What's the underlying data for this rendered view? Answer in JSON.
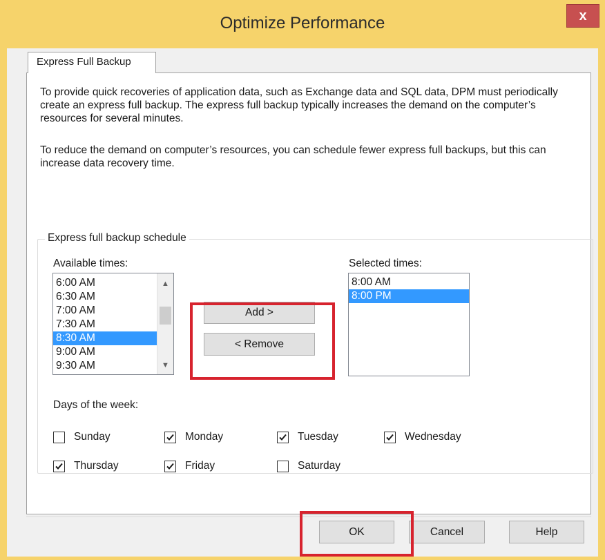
{
  "window": {
    "title": "Optimize Performance",
    "close_label": "x"
  },
  "tabs": [
    {
      "label": "Express Full Backup"
    }
  ],
  "description": {
    "para1": "To provide quick recoveries of application data, such as Exchange data and SQL data, DPM must periodically create an express full backup. The express full backup typically increases the demand on the computer’s resources for several minutes.",
    "para2": "To reduce the demand on computer’s resources, you can schedule fewer express full backups, but this can increase data recovery time."
  },
  "schedule": {
    "group_title": "Express full backup schedule",
    "available_label": "Available times:",
    "available_times": [
      {
        "label": "6:00 AM",
        "selected": false
      },
      {
        "label": "6:30 AM",
        "selected": false
      },
      {
        "label": "7:00 AM",
        "selected": false
      },
      {
        "label": "7:30 AM",
        "selected": false
      },
      {
        "label": "8:30 AM",
        "selected": true
      },
      {
        "label": "9:00 AM",
        "selected": false
      },
      {
        "label": "9:30 AM",
        "selected": false
      }
    ],
    "selected_label": "Selected times:",
    "selected_times": [
      {
        "label": "8:00 AM",
        "selected": false
      },
      {
        "label": "8:00 PM",
        "selected": true
      }
    ],
    "add_label": "Add >",
    "remove_label": "< Remove",
    "days_label": "Days of the week:",
    "days": [
      {
        "label": "Sunday",
        "checked": false
      },
      {
        "label": "Monday",
        "checked": true
      },
      {
        "label": "Tuesday",
        "checked": true
      },
      {
        "label": "Wednesday",
        "checked": true
      },
      {
        "label": "Thursday",
        "checked": true
      },
      {
        "label": "Friday",
        "checked": true
      },
      {
        "label": "Saturday",
        "checked": false
      }
    ]
  },
  "footer": {
    "ok_label": "OK",
    "cancel_label": "Cancel",
    "help_label": "Help"
  },
  "colors": {
    "title_bar": "#f6d36b",
    "close_button": "#c75050",
    "selection": "#3399ff",
    "highlight_box": "#d7232e"
  }
}
